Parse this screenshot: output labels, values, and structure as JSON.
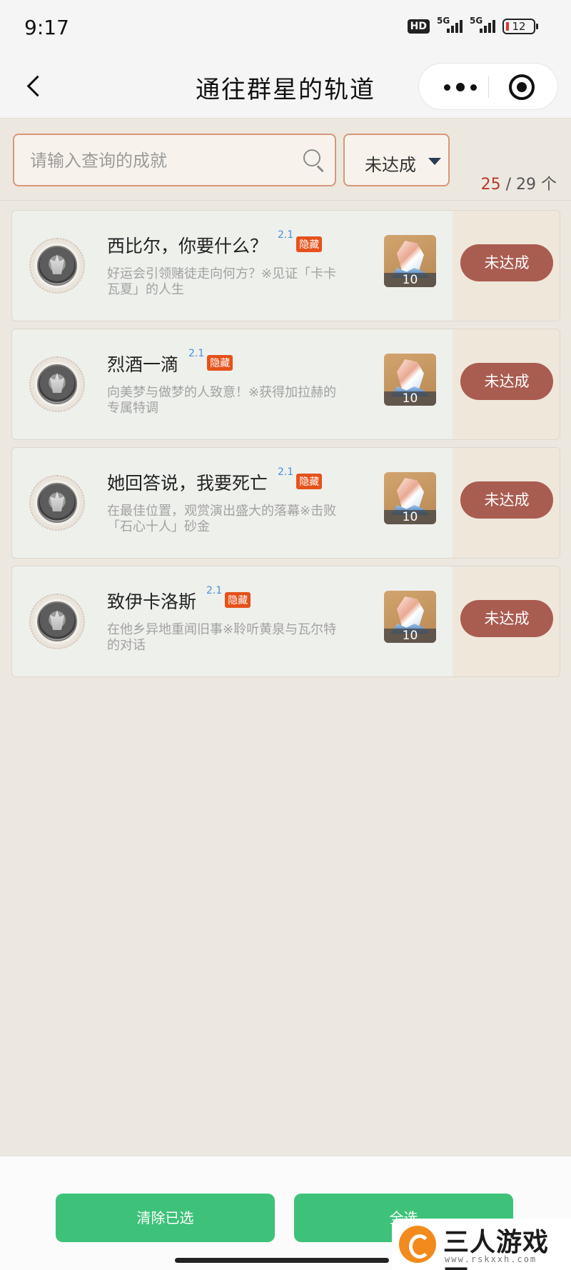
{
  "status_bar": {
    "time": "9:17",
    "network_label": "HD",
    "signal_1": "5G",
    "signal_2": "5G",
    "battery": "12"
  },
  "nav": {
    "title": "通往群星的轨道"
  },
  "filter": {
    "search_placeholder": "请输入查询的成就",
    "status_selected": "未达成",
    "count_current": "25",
    "count_total": "/ 29 个"
  },
  "achievements": [
    {
      "title": "西比尔，你要什么？",
      "version": "2.1",
      "tag": "隐藏",
      "desc": "好运会引领赌徒走向何方？※见证「卡卡瓦夏」的人生",
      "reward_qty": "10",
      "status": "未达成"
    },
    {
      "title": "烈酒一滴",
      "version": "2.1",
      "tag": "隐藏",
      "desc": "向美梦与做梦的人致意！※获得加拉赫的专属特调",
      "reward_qty": "10",
      "status": "未达成"
    },
    {
      "title": "她回答说，我要死亡",
      "version": "2.1",
      "tag": "隐藏",
      "desc": "在最佳位置，观赏演出盛大的落幕※击败「石心十人」砂金",
      "reward_qty": "10",
      "status": "未达成"
    },
    {
      "title": "致伊卡洛斯",
      "version": "2.1",
      "tag": "隐藏",
      "desc": "在他乡异地重闻旧事※聆听黄泉与瓦尔特的对话",
      "reward_qty": "10",
      "status": "未达成"
    }
  ],
  "bottom": {
    "clear_label": "清除已选",
    "select_all_label": "全选"
  },
  "watermark": {
    "name": "三人游戏网",
    "url": "www.rskxxh.com"
  },
  "colors": {
    "accent_border": "#d9967a",
    "status_button": "#a95c50",
    "primary_green": "#3ec27a",
    "hidden_tag": "#e5521b",
    "version_blue": "#4a90d9"
  }
}
